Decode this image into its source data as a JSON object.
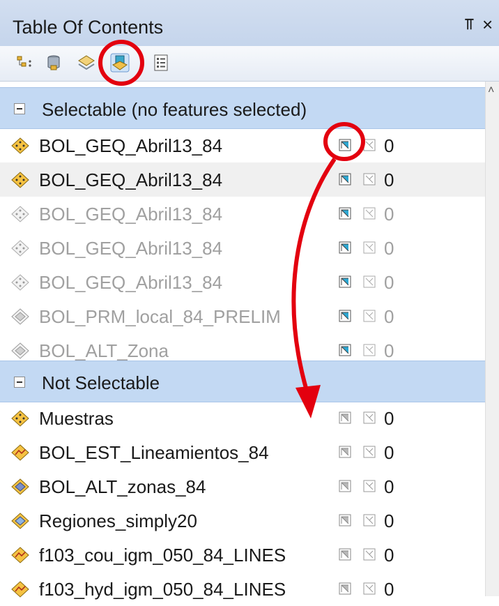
{
  "window": {
    "title": "Table Of Contents",
    "pin_glyph": "⫪",
    "close_glyph": "×"
  },
  "toolbar": {
    "buttons": [
      {
        "name": "list-by-drawing-order-icon"
      },
      {
        "name": "list-by-source-icon"
      },
      {
        "name": "list-by-visibility-icon"
      },
      {
        "name": "list-by-selection-icon",
        "active": true
      },
      {
        "name": "options-icon"
      }
    ]
  },
  "groups": {
    "selectable": {
      "label": "Selectable (no features selected)"
    },
    "not_selectable": {
      "label": "Not Selectable"
    }
  },
  "selectable_layers": [
    {
      "name": "BOL_GEQ_Abril13_84",
      "count": "0"
    },
    {
      "name": "BOL_GEQ_Abril13_84",
      "count": "0"
    },
    {
      "name": "BOL_GEQ_Abril13_84",
      "count": "0"
    },
    {
      "name": "BOL_GEQ_Abril13_84",
      "count": "0"
    },
    {
      "name": "BOL_GEQ_Abril13_84",
      "count": "0"
    },
    {
      "name": "BOL_PRM_local_84_PRELIM",
      "count": "0"
    },
    {
      "name": "BOL_ALT_Zona",
      "count": "0"
    }
  ],
  "not_selectable_layers": [
    {
      "name": "Muestras",
      "count": "0"
    },
    {
      "name": "BOL_EST_Lineamientos_84",
      "count": "0"
    },
    {
      "name": "BOL_ALT_zonas_84",
      "count": "0"
    },
    {
      "name": "Regiones_simply20",
      "count": "0"
    },
    {
      "name": "f103_cou_igm_050_84_LINES",
      "count": "0"
    },
    {
      "name": "f103_hyd_igm_050_84_LINES",
      "count": "0"
    }
  ],
  "colors": {
    "group_header": "#c3d9f3",
    "annotation_red": "#e3000f",
    "point_layer": "#f5c242",
    "polygon_layer": "#7a8fc8"
  },
  "scrollbar": {
    "up_glyph": "˄"
  }
}
